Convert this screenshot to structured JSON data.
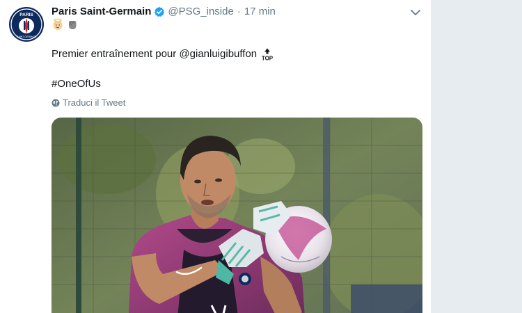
{
  "tweet": {
    "display_name": "Paris Saint-Germain",
    "handle": "@PSG_inside",
    "separator": "·",
    "time": "17 min",
    "avatar_text": {
      "top": "PARIS",
      "bottom": "SAINT-GERMAIN"
    },
    "emojis": [
      "angel-face-icon",
      "raised-fist-icon"
    ],
    "text_prefix": "Premier entraînement pour ",
    "mention": "@gianluigibuffon",
    "text_emoji": "top-arrow-icon",
    "text_emoji_label": "TOP",
    "hashtag": "#OneOfUs",
    "translate_label": "Traduci il Tweet"
  },
  "colors": {
    "accent": "#1da1f2",
    "secondary_text": "#657786",
    "primary_text": "#14171a",
    "psg_navy": "#0d2a5c",
    "psg_red": "#d4202c"
  }
}
